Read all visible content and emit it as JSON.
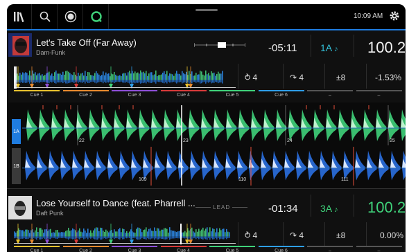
{
  "topbar": {
    "clock": "10:09 AM"
  },
  "deck_a": {
    "title": "Let's Take Off (Far Away)",
    "artist": "Dam-Funk",
    "remaining": "-05:11",
    "key": "1A",
    "bpm": "100.2",
    "loop": "4",
    "jump": "4",
    "range": "±8",
    "pitch": "-1.53%"
  },
  "deck_b": {
    "title": "Lose Yourself to Dance (feat. Pharrell ...",
    "artist": "Daft Punk",
    "lead_label": "LEAD",
    "remaining": "-01:34",
    "key": "3A",
    "bpm": "100.2",
    "loop": "4",
    "jump": "4",
    "range": "±8",
    "pitch": "0.00%"
  },
  "cues": [
    "Cue 1",
    "Cue 2",
    "Cue 3",
    "Cue 4",
    "Cue 5",
    "Cue 6",
    "–",
    "–"
  ],
  "cue_colors": [
    "#e8c22e",
    "#e88a2e",
    "#8e4fd8",
    "#d83a3a",
    "#3fd27a",
    "#2e9ee8",
    "#555555",
    "#555555"
  ],
  "waveform": {
    "lane_a_label": "1A",
    "lane_b_label": "1B",
    "beats_a": [
      "22",
      "23",
      "24",
      "25"
    ],
    "beats_b": [
      "109",
      "110",
      "111"
    ]
  },
  "icons": {
    "library": "library-icon",
    "search": "search-icon",
    "record": "record-icon",
    "sync": "sync-icon",
    "settings": "gear-icon",
    "loop": "loop-icon",
    "jump": "jump-icon",
    "key": "note-icon"
  }
}
